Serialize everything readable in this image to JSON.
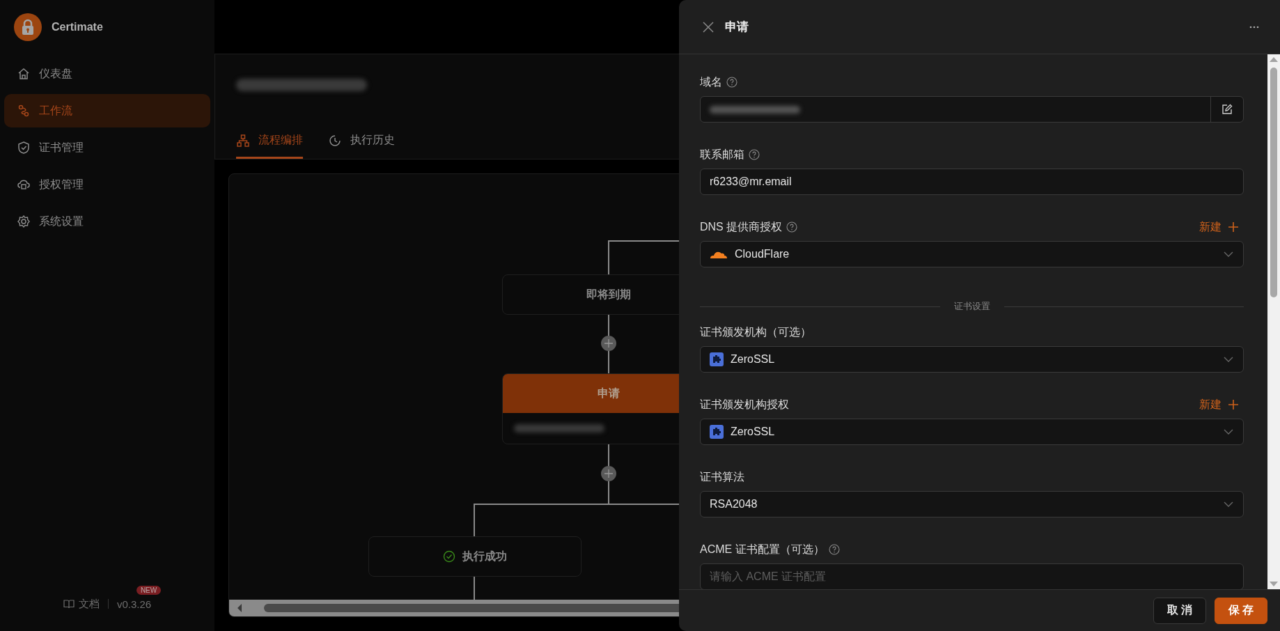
{
  "app": {
    "name": "Certimate"
  },
  "sidebar": {
    "items": [
      {
        "label": "仪表盘",
        "selected": false
      },
      {
        "label": "工作流",
        "selected": true
      },
      {
        "label": "证书管理",
        "selected": false
      },
      {
        "label": "授权管理",
        "selected": false
      },
      {
        "label": "系统设置",
        "selected": false
      }
    ],
    "docs_link": "文档",
    "version": "v0.3.26",
    "version_badge": "NEW"
  },
  "tabs": [
    {
      "label": "流程编排",
      "selected": true
    },
    {
      "label": "执行历史",
      "selected": false
    }
  ],
  "flow": {
    "nodes": [
      {
        "kind": "condition",
        "label": "即将到期"
      },
      {
        "kind": "action",
        "label": "申请"
      },
      {
        "kind": "result",
        "label": "执行成功"
      }
    ]
  },
  "drawer": {
    "title": "申请",
    "fields": [
      {
        "kind": "text-edit",
        "label": "域名",
        "help": true
      },
      {
        "kind": "text",
        "label": "联系邮箱",
        "help": true,
        "value": "r6233@mr.email"
      },
      {
        "kind": "select",
        "label": "DNS 提供商授权",
        "help": true,
        "action": "新建",
        "option": {
          "kind": "cloud",
          "label": "CloudFlare"
        }
      },
      {
        "kind": "divider",
        "label": "证书设置"
      },
      {
        "kind": "select",
        "label": "证书颁发机构（可选）",
        "help": false,
        "option": {
          "kind": "puzzle",
          "label": "ZeroSSL"
        }
      },
      {
        "kind": "select",
        "label": "证书颁发机构授权",
        "help": false,
        "action": "新建",
        "option": {
          "kind": "puzzle",
          "label": "ZeroSSL"
        }
      },
      {
        "kind": "select",
        "label": "证书算法",
        "help": false,
        "option": {
          "kind": "plain",
          "label": "RSA2048"
        }
      },
      {
        "kind": "text",
        "label": "ACME 证书配置（可选）",
        "help": true,
        "placeholder": "请输入 ACME 证书配置"
      }
    ],
    "buttons": [
      {
        "kind": "default",
        "label": "取 消"
      },
      {
        "kind": "primary",
        "label": "保 存"
      }
    ]
  }
}
